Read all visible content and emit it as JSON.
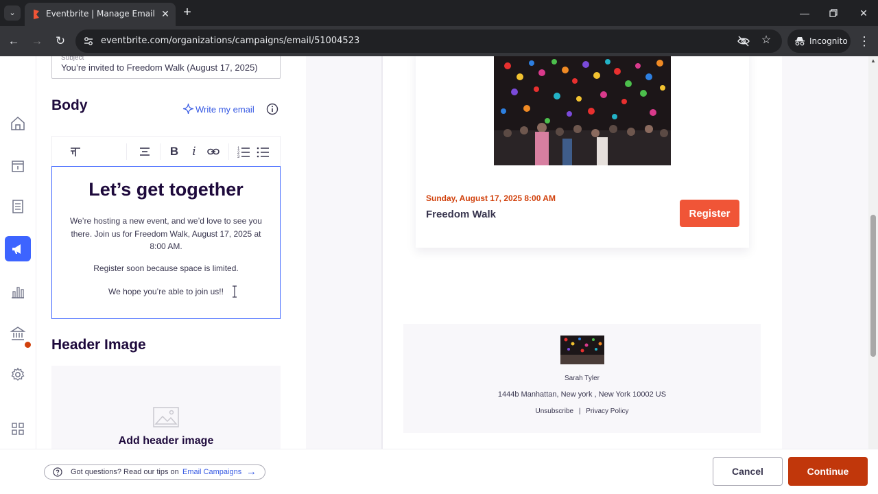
{
  "browser": {
    "tab_title": "Eventbrite | Manage Email Campaigns",
    "url": "eventbrite.com/organizations/campaigns/email/51004523",
    "incognito_label": "Incognito"
  },
  "editor": {
    "subject_label": "Subject",
    "subject_value": "You’re invited to Freedom Walk (August 17, 2025)",
    "body_heading": "Body",
    "write_my_email": "Write my email",
    "content": {
      "title": "Let’s get together",
      "paragraph1": "We’re hosting a new event, and we’d love to see you there. Join us for Freedom Walk, August 17, 2025 at 8:00 AM.",
      "paragraph2": "Register soon because space is limited.",
      "paragraph3": "We hope you’re able to join us!!"
    },
    "header_image_heading": "Header Image",
    "add_header_image": "Add header image"
  },
  "preview": {
    "event_date": "Sunday, August 17, 2025 8:00 AM",
    "event_name": "Freedom Walk",
    "register_label": "Register",
    "organizer_name": "Sarah Tyler",
    "organizer_address": "1444b Manhattan, New york , New York 10002 US",
    "unsubscribe": "Unsubscribe",
    "link_separator": "|",
    "privacy_policy": "Privacy Policy"
  },
  "footer": {
    "questions_text": "Got questions? Read our tips on",
    "questions_link": "Email Campaigns",
    "cancel_label": "Cancel",
    "continue_label": "Continue"
  },
  "colors": {
    "accent_blue": "#3d64ff",
    "eventbrite_orange": "#f05537",
    "continue_red": "#c1370b",
    "text_dark": "#1e0a3c"
  }
}
